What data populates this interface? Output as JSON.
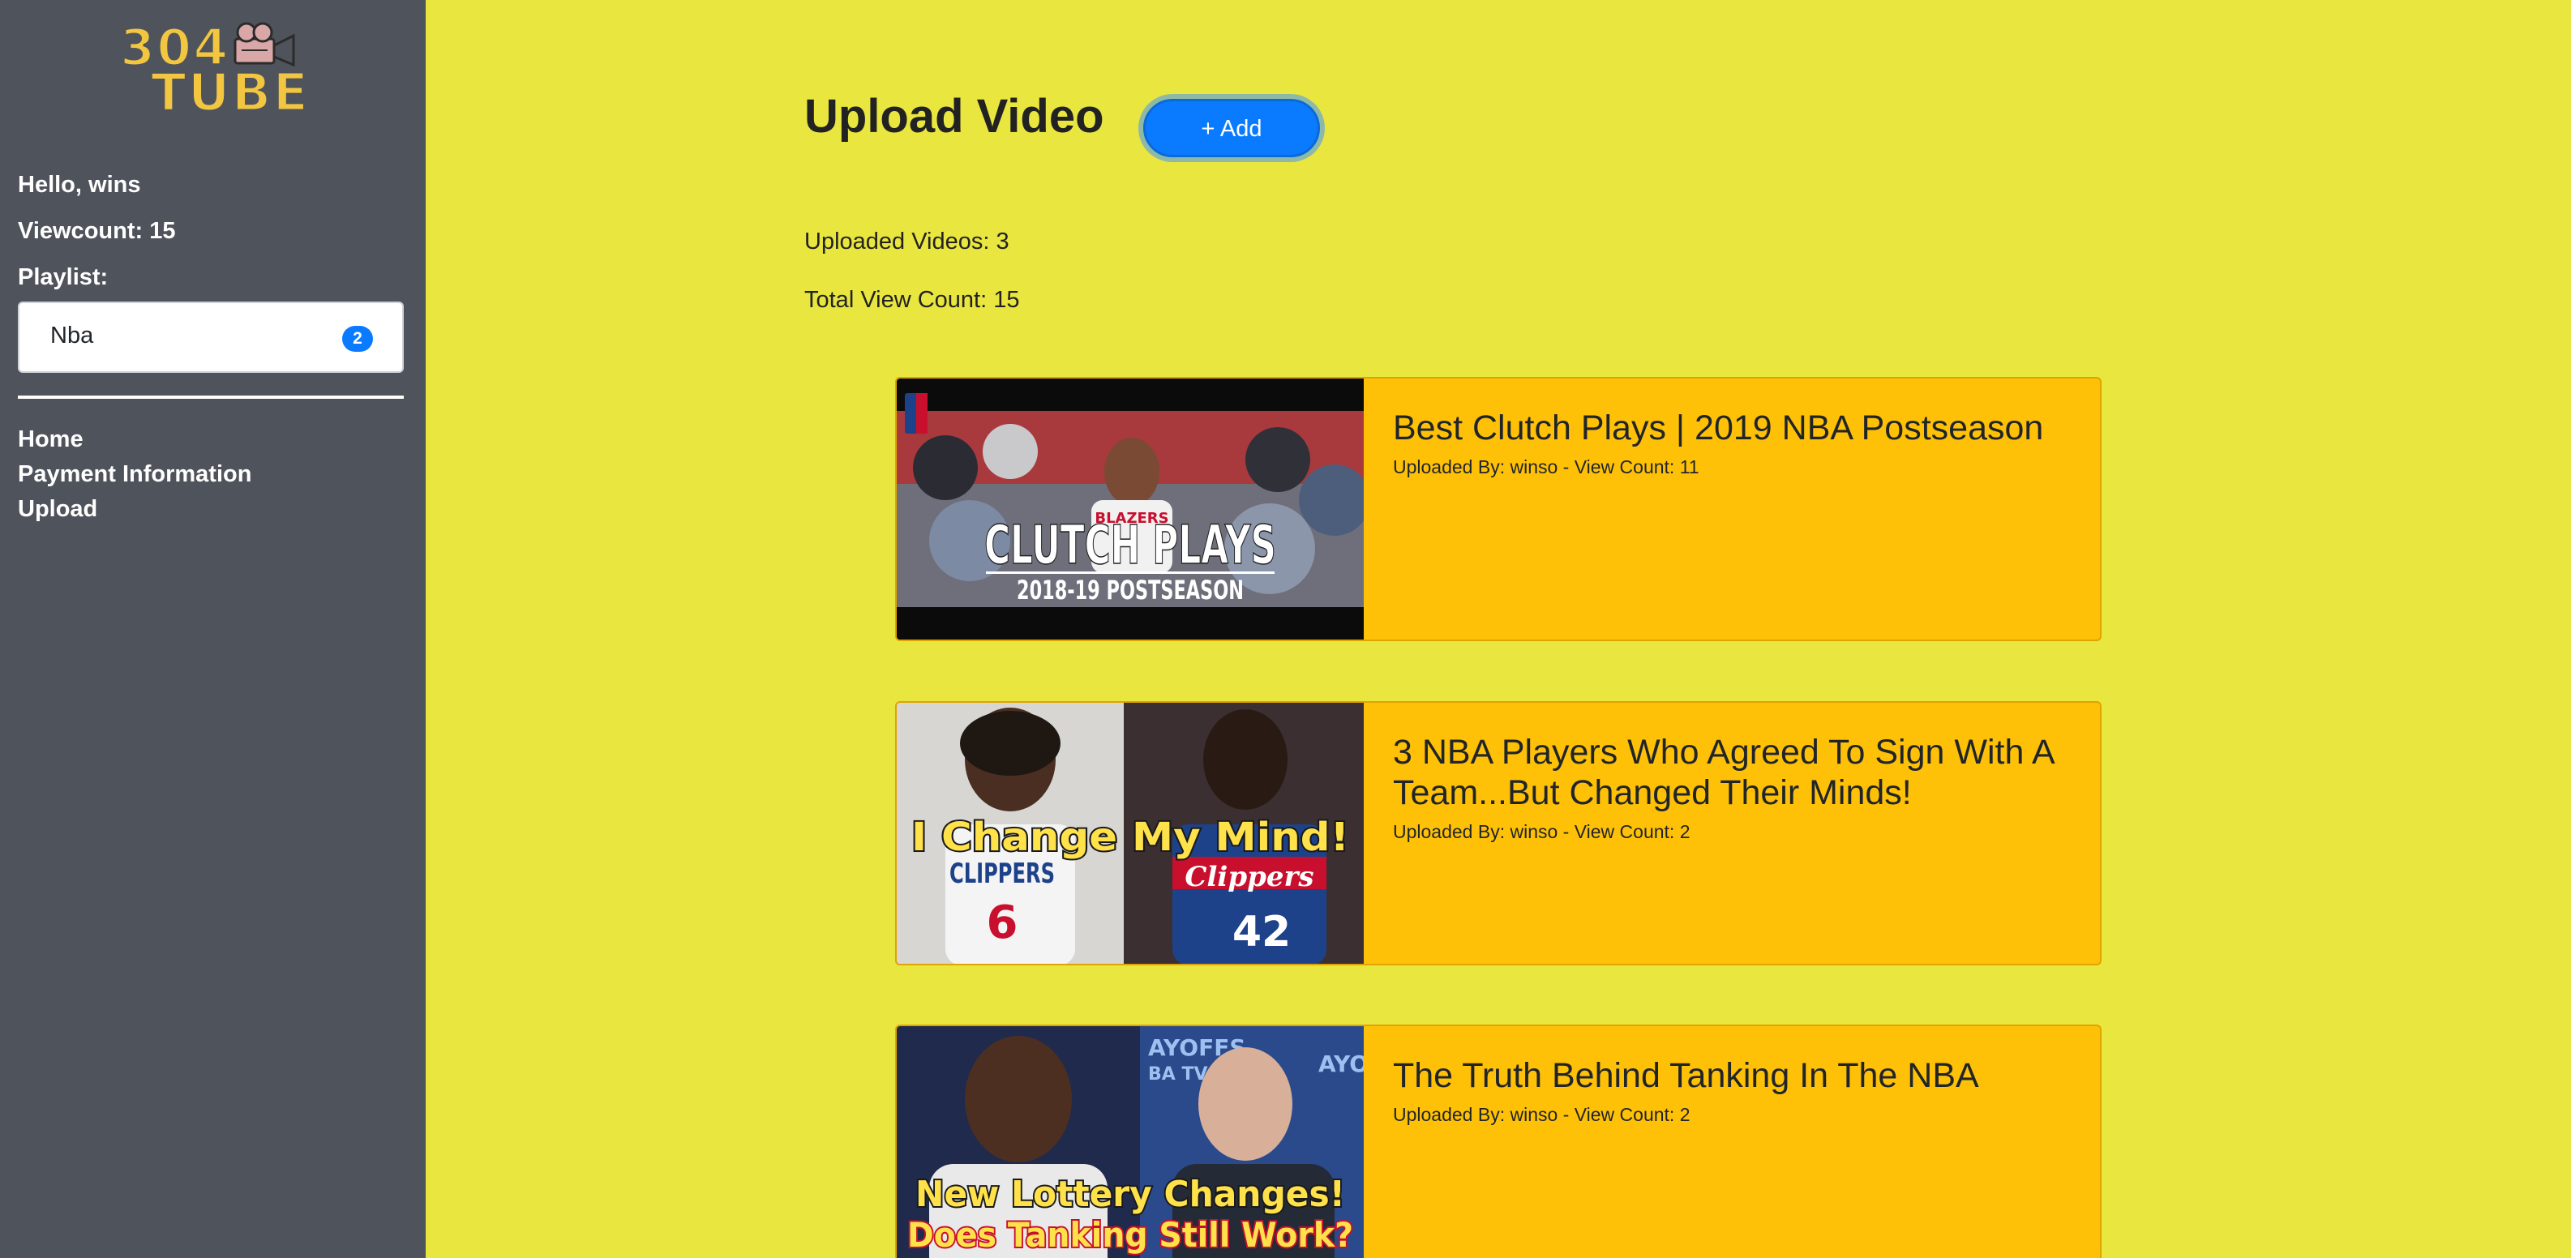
{
  "sidebar": {
    "logo_line1": "304",
    "logo_line2": "TUBE",
    "greeting": "Hello, wins",
    "viewcount": "Viewcount: 15",
    "playlist_heading": "Playlist:",
    "playlists": [
      {
        "name": "Nba",
        "count": "2"
      }
    ],
    "nav": [
      "Home",
      "Payment Information",
      "Upload"
    ]
  },
  "main": {
    "title": "Upload Video",
    "add_label": "+ Add",
    "uploaded_videos": "Uploaded Videos: 3",
    "total_view_count": "Total View Count: 15"
  },
  "videos": [
    {
      "title": "Best Clutch Plays | 2019 NBA Postseason",
      "meta": "Uploaded By: winso - View Count: 11",
      "thumb_line1": "CLUTCH PLAYS",
      "thumb_line2": "2018-19 POSTSEASON",
      "thumb_jersey": "BLAZERS"
    },
    {
      "title": "3 NBA Players Who Agreed To Sign With A Team...But Changed Their Minds!",
      "meta": "Uploaded By: winso - View Count: 2",
      "thumb_line1": "I Change My Mind!",
      "thumb_jersey1": "CLIPPERS",
      "thumb_number1": "6",
      "thumb_jersey2": "Clippers",
      "thumb_number2": "42"
    },
    {
      "title": "The Truth Behind Tanking In The NBA",
      "meta": "Uploaded By: winso - View Count: 2",
      "thumb_line1": "New Lottery Changes!",
      "thumb_line2": "Does Tanking Still Work?",
      "thumb_backdrop1": "AYOFFS",
      "thumb_backdrop2": "BA TV",
      "thumb_backdrop3": "AYO"
    }
  ],
  "colors": {
    "page_background": "#e9e63f",
    "sidebar_background": "#4f535b",
    "card_background": "#ffc107",
    "accent_blue": "#0a7bff",
    "logo_yellow": "#f2c640"
  },
  "icons": {
    "logo_camera": "movie-camera-icon"
  }
}
